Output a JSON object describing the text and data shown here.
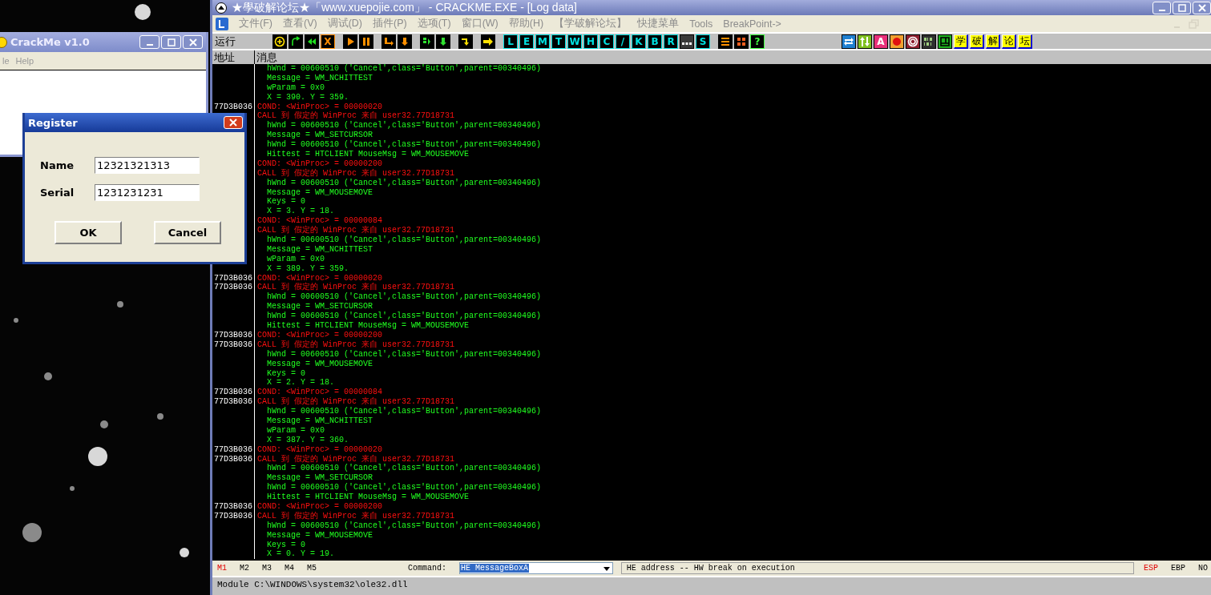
{
  "crackme_window": {
    "title": "CrackMe v1.0",
    "menu": [
      "le",
      "Help"
    ]
  },
  "register_dialog": {
    "title": "Register",
    "fields": [
      {
        "label": "Name",
        "value": "12321321313"
      },
      {
        "label": "Serial",
        "value": "1231231231"
      }
    ],
    "buttons": [
      "OK",
      "Cancel"
    ]
  },
  "debugger": {
    "title": "★學破解论坛★「www.xuepojie.com」 - CRACKME.EXE - [Log data]",
    "menu": [
      "文件(F)",
      "查看(V)",
      "调试(D)",
      "插件(P)",
      "选项(T)",
      "窗口(W)",
      "帮助(H)",
      "【学破解论坛】",
      "快捷菜单",
      "Tools",
      "BreakPoint->"
    ],
    "toolbar": {
      "label": "运行",
      "groups": [
        [
          {
            "kind": "icon"
          },
          {
            "kind": "icon"
          },
          {
            "kind": "icon"
          },
          {
            "kind": "glyph",
            "label": "X",
            "color": "#ff8c00"
          }
        ],
        [
          {
            "kind": "icon"
          },
          {
            "kind": "icon"
          }
        ],
        [
          {
            "kind": "icon"
          },
          {
            "kind": "icon"
          }
        ],
        [
          {
            "kind": "icon"
          },
          {
            "kind": "icon"
          }
        ],
        [
          {
            "kind": "icon"
          }
        ],
        [
          {
            "kind": "icon"
          }
        ],
        [
          {
            "kind": "glyph",
            "label": "L",
            "color": "#00e0e0"
          },
          {
            "kind": "glyph",
            "label": "E",
            "color": "#00e0e0"
          },
          {
            "kind": "glyph",
            "label": "M",
            "color": "#00e0e0"
          },
          {
            "kind": "glyph",
            "label": "T",
            "color": "#00e0e0"
          },
          {
            "kind": "glyph",
            "label": "W",
            "color": "#00e0e0"
          },
          {
            "kind": "glyph",
            "label": "H",
            "color": "#00e0e0"
          },
          {
            "kind": "glyph",
            "label": "C",
            "color": "#00e0e0"
          },
          {
            "kind": "glyph",
            "label": "/",
            "color": "#00e0e0"
          },
          {
            "kind": "glyph",
            "label": "K",
            "color": "#00e0e0"
          },
          {
            "kind": "glyph",
            "label": "B",
            "color": "#00e0e0"
          },
          {
            "kind": "glyph",
            "label": "R",
            "color": "#00e0e0"
          },
          {
            "kind": "icon"
          },
          {
            "kind": "glyph",
            "label": "S",
            "color": "#00e0e0"
          }
        ],
        [
          {
            "kind": "icon"
          },
          {
            "kind": "icon"
          },
          {
            "kind": "glyph",
            "label": "?",
            "color": "#40ff40"
          }
        ],
        [
          {
            "kind": "icon"
          },
          {
            "kind": "icon"
          },
          {
            "kind": "tile",
            "label": "A",
            "color": "#e8307a"
          },
          {
            "kind": "icon"
          },
          {
            "kind": "icon"
          },
          {
            "kind": "icon"
          },
          {
            "kind": "icon"
          },
          {
            "kind": "cjk",
            "label": "学"
          },
          {
            "kind": "cjk",
            "label": "破"
          },
          {
            "kind": "cjk",
            "label": "解"
          },
          {
            "kind": "cjk",
            "label": "论"
          },
          {
            "kind": "cjk",
            "label": "坛"
          }
        ]
      ]
    },
    "columns": [
      "地址",
      "消息"
    ],
    "log": [
      {
        "kind": "detail",
        "text": "hWnd = 00600510 ('Cancel',class='Button',parent=00340496)"
      },
      {
        "kind": "detail",
        "text": "Message = WM_NCHITTEST"
      },
      {
        "kind": "detail",
        "text": "wParam = 0x0"
      },
      {
        "kind": "detail",
        "text": "X = 390. Y = 359."
      },
      {
        "kind": "cond",
        "address": "77D3B036",
        "text": "COND: <WinProc> = 00000020"
      },
      {
        "kind": "call",
        "text": "CALL 到 假定的 WinProc 来自 user32.77D18731"
      },
      {
        "kind": "detail",
        "text": "hWnd = 00600510 ('Cancel',class='Button',parent=00340496)"
      },
      {
        "kind": "detail",
        "text": "Message = WM_SETCURSOR"
      },
      {
        "kind": "detail",
        "text": "hWnd = 00600510 ('Cancel',class='Button',parent=00340496)"
      },
      {
        "kind": "detail",
        "text": "Hittest = HTCLIENT MouseMsg = WM_MOUSEMOVE"
      },
      {
        "kind": "cond",
        "text": "COND: <WinProc> = 00000200"
      },
      {
        "kind": "call",
        "text": "CALL 到 假定的 WinProc 来自 user32.77D18731"
      },
      {
        "kind": "detail",
        "text": "hWnd = 00600510 ('Cancel',class='Button',parent=00340496)"
      },
      {
        "kind": "detail",
        "text": "Message = WM_MOUSEMOVE"
      },
      {
        "kind": "detail",
        "text": "Keys = 0"
      },
      {
        "kind": "detail",
        "text": "X = 3. Y = 18."
      },
      {
        "kind": "cond",
        "text": "COND: <WinProc> = 00000084"
      },
      {
        "kind": "call",
        "text": "CALL 到 假定的 WinProc 来自 user32.77D18731"
      },
      {
        "kind": "detail",
        "text": "hWnd = 00600510 ('Cancel',class='Button',parent=00340496)"
      },
      {
        "kind": "detail",
        "text": "Message = WM_NCHITTEST"
      },
      {
        "kind": "detail",
        "text": "wParam = 0x0"
      },
      {
        "kind": "detail",
        "text": "X = 389. Y = 359."
      },
      {
        "kind": "cond",
        "address": "77D3B036",
        "text": "COND: <WinProc> = 00000020"
      },
      {
        "kind": "call",
        "address": "77D3B036",
        "text": "CALL 到 假定的 WinProc 来自 user32.77D18731"
      },
      {
        "kind": "detail",
        "text": "hWnd = 00600510 ('Cancel',class='Button',parent=00340496)"
      },
      {
        "kind": "detail",
        "text": "Message = WM_SETCURSOR"
      },
      {
        "kind": "detail",
        "text": "hWnd = 00600510 ('Cancel',class='Button',parent=00340496)"
      },
      {
        "kind": "detail",
        "text": "Hittest = HTCLIENT MouseMsg = WM_MOUSEMOVE"
      },
      {
        "kind": "cond",
        "address": "77D3B036",
        "text": "COND: <WinProc> = 00000200"
      },
      {
        "kind": "call",
        "address": "77D3B036",
        "text": "CALL 到 假定的 WinProc 来自 user32.77D18731"
      },
      {
        "kind": "detail",
        "text": "hWnd = 00600510 ('Cancel',class='Button',parent=00340496)"
      },
      {
        "kind": "detail",
        "text": "Message = WM_MOUSEMOVE"
      },
      {
        "kind": "detail",
        "text": "Keys = 0"
      },
      {
        "kind": "detail",
        "text": "X = 2. Y = 18."
      },
      {
        "kind": "cond",
        "address": "77D3B036",
        "text": "COND: <WinProc> = 00000084"
      },
      {
        "kind": "call",
        "address": "77D3B036",
        "text": "CALL 到 假定的 WinProc 来自 user32.77D18731"
      },
      {
        "kind": "detail",
        "text": "hWnd = 00600510 ('Cancel',class='Button',parent=00340496)"
      },
      {
        "kind": "detail",
        "text": "Message = WM_NCHITTEST"
      },
      {
        "kind": "detail",
        "text": "wParam = 0x0"
      },
      {
        "kind": "detail",
        "text": "X = 387. Y = 360."
      },
      {
        "kind": "cond",
        "address": "77D3B036",
        "text": "COND: <WinProc> = 00000020"
      },
      {
        "kind": "call",
        "address": "77D3B036",
        "text": "CALL 到 假定的 WinProc 来自 user32.77D18731"
      },
      {
        "kind": "detail",
        "text": "hWnd = 00600510 ('Cancel',class='Button',parent=00340496)"
      },
      {
        "kind": "detail",
        "text": "Message = WM_SETCURSOR"
      },
      {
        "kind": "detail",
        "text": "hWnd = 00600510 ('Cancel',class='Button',parent=00340496)"
      },
      {
        "kind": "detail",
        "text": "Hittest = HTCLIENT MouseMsg = WM_MOUSEMOVE"
      },
      {
        "kind": "cond",
        "address": "77D3B036",
        "text": "COND: <WinProc> = 00000200"
      },
      {
        "kind": "call",
        "address": "77D3B036",
        "text": "CALL 到 假定的 WinProc 来自 user32.77D18731"
      },
      {
        "kind": "detail",
        "text": "hWnd = 00600510 ('Cancel',class='Button',parent=00340496)"
      },
      {
        "kind": "detail",
        "text": "Message = WM_MOUSEMOVE"
      },
      {
        "kind": "detail",
        "text": "Keys = 0"
      },
      {
        "kind": "detail",
        "text": "X = 0. Y = 19."
      }
    ],
    "command_bar": {
      "marks": [
        {
          "label": "M1",
          "selected": true
        },
        {
          "label": "M2",
          "selected": false
        },
        {
          "label": "M3",
          "selected": false
        },
        {
          "label": "M4",
          "selected": false
        },
        {
          "label": "M5",
          "selected": false
        }
      ],
      "command_label": "Command:",
      "command_value": "HE MessageBoxA",
      "hint": "HE address -- HW break on execution",
      "registers": [
        {
          "label": "ESP",
          "selected": true
        },
        {
          "label": "EBP",
          "selected": false
        },
        {
          "label": "NO",
          "selected": false
        }
      ]
    },
    "status_bar": "Module C:\\WINDOWS\\system32\\ole32.dll"
  }
}
